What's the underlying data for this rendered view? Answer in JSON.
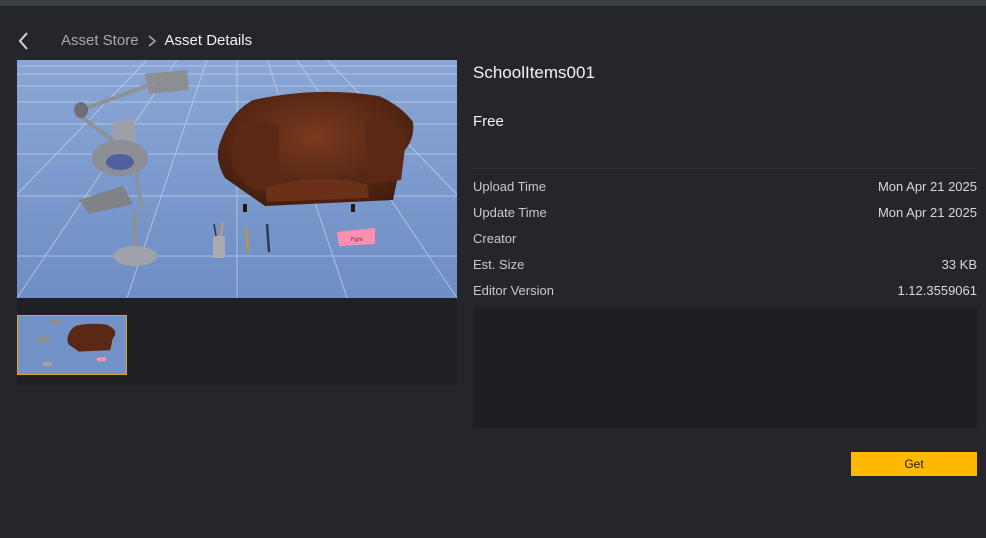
{
  "breadcrumb": {
    "parent": "Asset Store",
    "current": "Asset Details"
  },
  "asset": {
    "title": "SchoolItems001",
    "price": "Free",
    "preview_eraser_text": "Fight"
  },
  "meta": [
    {
      "label": "Upload Time",
      "value": "Mon Apr 21 2025"
    },
    {
      "label": "Update Time",
      "value": "Mon Apr 21 2025"
    },
    {
      "label": "Creator",
      "value": ""
    },
    {
      "label": "Est. Size",
      "value": "33 KB"
    },
    {
      "label": "Editor Version",
      "value": "1.12.3559061"
    }
  ],
  "actions": {
    "get_label": "Get"
  },
  "colors": {
    "accent": "#ffb800",
    "background": "#24262b",
    "panel": "#1d1f23"
  },
  "icons": {
    "back": "chevron-left-icon",
    "separator": "chevron-right-icon"
  }
}
